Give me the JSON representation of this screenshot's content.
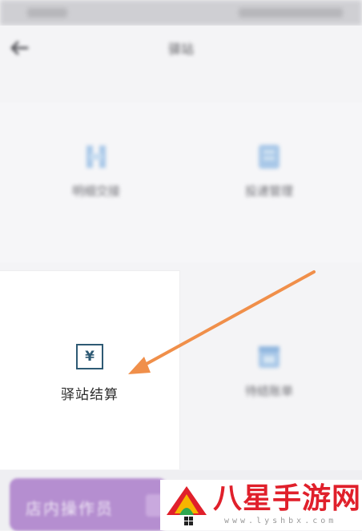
{
  "nav": {
    "title": "驿站"
  },
  "tiles": [
    {
      "label": "明细交接",
      "icon": "handover-icon"
    },
    {
      "label": "投递管理",
      "icon": "document-icon"
    },
    {
      "label": "驿站结算",
      "icon": "yen-icon",
      "glyph": "¥"
    },
    {
      "label": "待结账单",
      "icon": "calendar-icon"
    }
  ],
  "bottom": {
    "store_button": "店内操作员"
  },
  "watermark": {
    "title": "八星手游网",
    "url": "www.lyshbx.com"
  },
  "colors": {
    "accent": "#2e5a74",
    "arrow": "#f08f4a",
    "purple": "#b58ed0",
    "brand_red": "#e0202b"
  }
}
